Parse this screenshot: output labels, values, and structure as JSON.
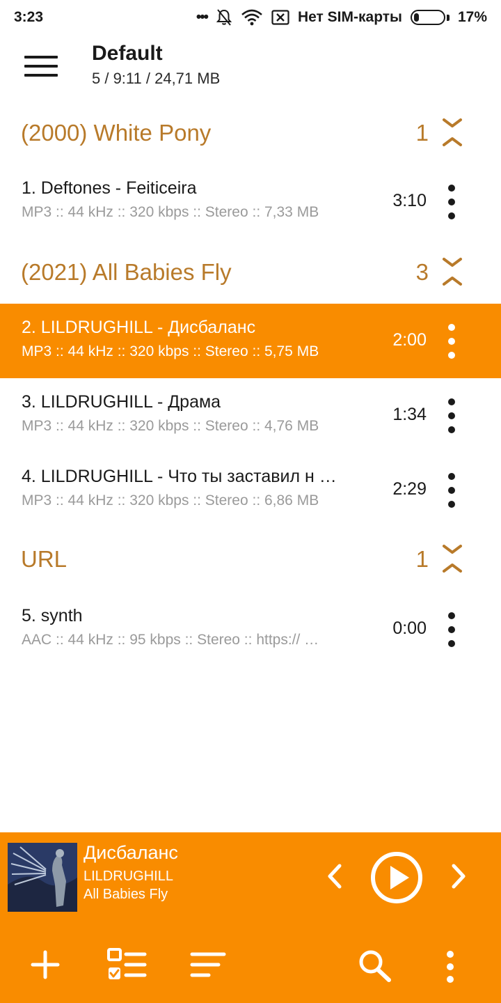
{
  "status_bar": {
    "time": "3:23",
    "overflow_dots": "•••",
    "sim_text": "Нет SIM-карты",
    "battery_percent": "17%",
    "battery_level": 0.17
  },
  "header": {
    "title": "Default",
    "subtitle": "5 / 9:11 / 24,71 MB"
  },
  "groups": [
    {
      "name": "(2000) White Pony",
      "count": "1"
    },
    {
      "name": "(2021) All Babies Fly",
      "count": "3"
    },
    {
      "name": "URL",
      "count": "1"
    }
  ],
  "tracks": [
    {
      "title": "1. Deftones - Feiticeira",
      "meta": "MP3 :: 44 kHz :: 320 kbps :: Stereo :: 7,33 MB",
      "duration": "3:10"
    },
    {
      "title": "2. LILDRUGHILL - Дисбаланс",
      "meta": "MP3 :: 44 kHz :: 320 kbps :: Stereo :: 5,75 MB",
      "duration": "2:00"
    },
    {
      "title": "3. LILDRUGHILL - Драма",
      "meta": "MP3 :: 44 kHz :: 320 kbps :: Stereo :: 4,76 MB",
      "duration": "1:34"
    },
    {
      "title": "4. LILDRUGHILL - Что ты заставил н  …",
      "meta": "MP3 :: 44 kHz :: 320 kbps :: Stereo :: 6,86 MB",
      "duration": "2:29"
    },
    {
      "title": "5. synth",
      "meta": "AAC :: 44 kHz :: 95 kbps :: Stereo :: https://  …",
      "duration": "0:00"
    }
  ],
  "now_playing": {
    "title": "Дисбаланс",
    "artist": "LILDRUGHILL",
    "album": "All Babies Fly"
  },
  "colors": {
    "accent": "#f98c00",
    "group_text": "#b87a2a",
    "meta_text": "#9a9a9a"
  },
  "icons": [
    "menu-icon",
    "chevron-collapse-icon",
    "more-vert-icon",
    "prev-icon",
    "play-icon",
    "next-icon",
    "add-icon",
    "checklist-icon",
    "sort-icon",
    "search-icon"
  ]
}
